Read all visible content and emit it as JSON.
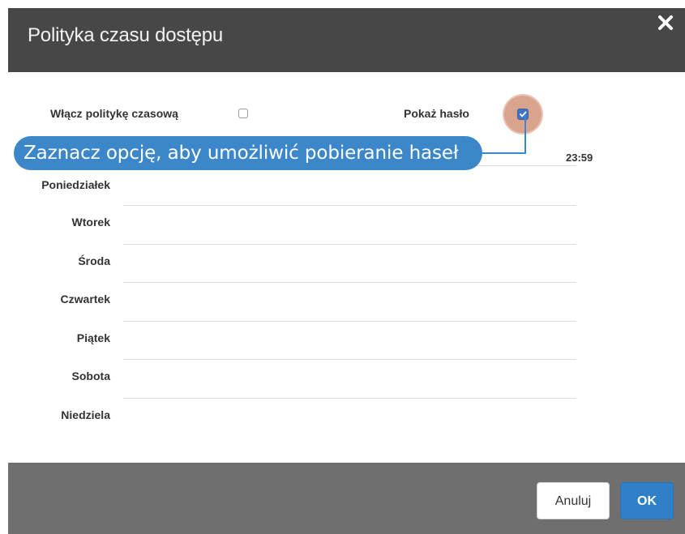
{
  "dialog": {
    "title": "Polityka czasu dostępu",
    "close_icon": "close-icon"
  },
  "options": {
    "enable_time_policy_label": "Włącz politykę czasową",
    "enable_time_policy_checked": false,
    "show_password_label": "Pokaż hasło",
    "show_password_checked": true
  },
  "schedule": {
    "end_time": "23:59",
    "days": [
      "Poniedziałek",
      "Wtorek",
      "Środa",
      "Czwartek",
      "Piątek",
      "Sobota",
      "Niedziela"
    ]
  },
  "callout": {
    "text": "Zaznacz opcję, aby umożliwić pobieranie haseł",
    "color": "#3b87c9"
  },
  "footer": {
    "cancel_label": "Anuluj",
    "ok_label": "OK"
  },
  "colors": {
    "header_bg": "#474747",
    "footer_bg": "#6f6f6f",
    "primary": "#2f80c8",
    "highlight": "#d9a48e"
  }
}
